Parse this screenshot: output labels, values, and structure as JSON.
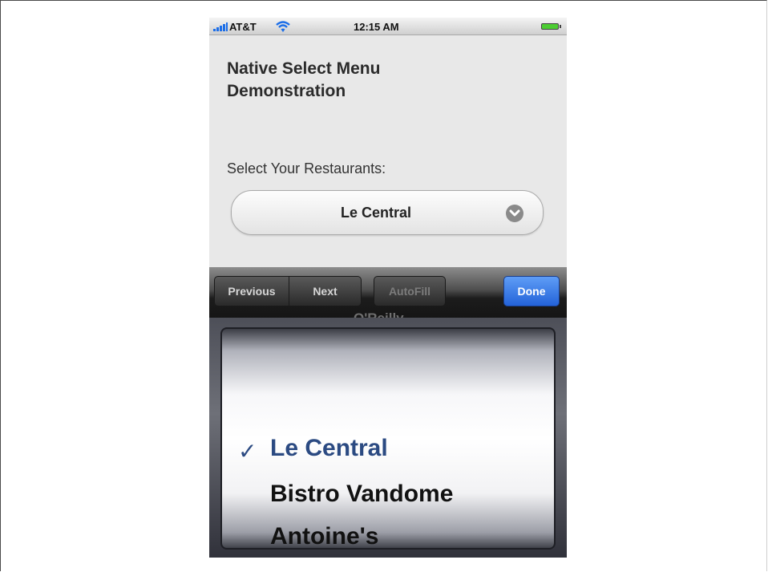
{
  "status_bar": {
    "carrier": "AT&T",
    "time": "12:15 AM",
    "signal_bars": 5,
    "battery_level": 1.0,
    "battery_color": "#4ccd32"
  },
  "page": {
    "title": "Native Select Menu Demonstration",
    "select_label": "Select Your Restaurants:",
    "select_value": "Le Central",
    "select_icon": "chevron-down-icon"
  },
  "toolbar": {
    "previous_label": "Previous",
    "next_label": "Next",
    "autofill_label": "AutoFill",
    "done_label": "Done",
    "done_color": "#2463d9"
  },
  "picker": {
    "partially_hidden_option": "O'Reilly",
    "options": [
      {
        "label": "Le Central",
        "selected": true
      },
      {
        "label": "Bistro Vandome",
        "selected": false
      },
      {
        "label": "Antoine's",
        "selected": false
      }
    ],
    "checkmark": "✓",
    "selected_color": "#2b4a82"
  }
}
